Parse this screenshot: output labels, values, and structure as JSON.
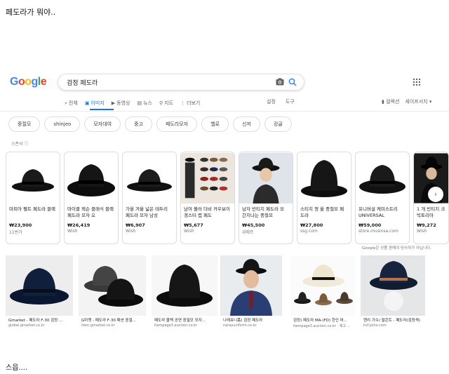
{
  "captions": {
    "top": "페도라가 뭐야..",
    "bottom": "스읍...."
  },
  "logo": {
    "letters": [
      "G",
      "o",
      "o",
      "g",
      "l",
      "e"
    ],
    "colors": [
      "#4285f4",
      "#ea4335",
      "#fbbc05",
      "#4285f4",
      "#34a853",
      "#ea4335"
    ]
  },
  "search": {
    "query": "검정 페도라",
    "camera_icon": "camera-icon",
    "search_icon": "search-icon"
  },
  "tabs": [
    {
      "label": "전체",
      "icon": "search-icon",
      "active": false
    },
    {
      "label": "이미지",
      "icon": "image-icon",
      "active": true
    },
    {
      "label": "동영상",
      "icon": "video-icon",
      "active": false
    },
    {
      "label": "뉴스",
      "icon": "news-icon",
      "active": false
    },
    {
      "label": "지도",
      "icon": "map-pin-icon",
      "active": false
    },
    {
      "label": "더보기",
      "icon": "more-icon",
      "active": false
    }
  ],
  "tools": {
    "settings": "설정",
    "tools": "도구"
  },
  "right": {
    "collections": "컬렉션",
    "safesearch": "세이프서치"
  },
  "chips": [
    "중절모",
    "shinjeo",
    "모자대여",
    "중고",
    "페도라모자",
    "헬로",
    "신저",
    "캉골"
  ],
  "sponsored": "스폰서",
  "products": [
    {
      "title": "마피아 펠트 페도라 블랙",
      "price": "₩23,900",
      "store": "11번가"
    },
    {
      "title": "마이클 잭슨 클래식 블랙 페도라 모자 오",
      "price": "₩26,419",
      "store": "Wish"
    },
    {
      "title": "가을 겨울 넓은 테두리 페도라 모자 남성",
      "price": "₩6,907",
      "store": "Wish"
    },
    {
      "title": "남여 볼러 더비 카우보이 갱스터 캡 페도",
      "price": "₩5,677",
      "store": "Wish"
    },
    {
      "title": "남자 빈티지 페도라 모 간지나는 중절모",
      "price": "₩45,500",
      "store": "위메프"
    },
    {
      "title": "스티치 챙 울 중절모 페도라",
      "price": "₩27,800",
      "store": "ssg.com"
    },
    {
      "title": "유니버설 케미스트리UNIVERSAL",
      "price": "₩59,000",
      "store": "store.musinsa.com"
    },
    {
      "title": "1 개 빈티지 크 빅토리아",
      "price": "₩9,272",
      "store": "Wish"
    }
  ],
  "disclaimer": "Google은 상품 판매의 당사자가 아닙니다.",
  "grid": [
    {
      "caption": "Gmarket - 페도라 F-30 검정 ...",
      "source": "global.gmarket.co.kr"
    },
    {
      "caption": "G마켓 - 페도라 F-30 패션 중절...",
      "source": "item.gmarket.co.kr"
    },
    {
      "caption": "페도라 블랙 공연 중절모 모자...",
      "source": "itempage3.auction.co.kr"
    },
    {
      "caption": "나래유니폼) 검정 페도라",
      "source": "narayuniform.co.kr"
    },
    {
      "caption": "검정) 페도라 MA-(FD) 한인 머...",
      "source": "itempage3.auction.co.kr · 재고 ..."
    },
    {
      "caption": "헨리 가수/ 팔콘트 - 페도라(검정색)",
      "source": "kvf.joins.com"
    }
  ]
}
